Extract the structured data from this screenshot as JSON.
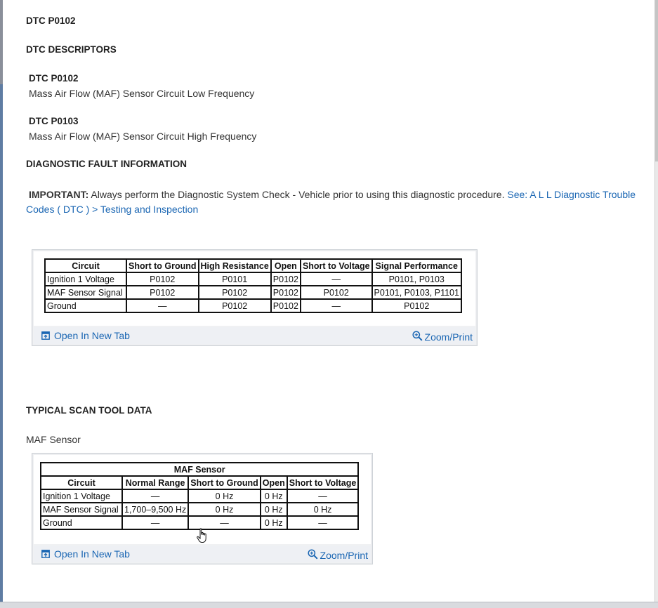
{
  "page": {
    "dtc_title": "DTC P0102",
    "descriptors_heading": "DTC DESCRIPTORS",
    "descriptors": [
      {
        "code": "DTC P0102",
        "desc": "Mass Air Flow (MAF) Sensor Circuit Low Frequency"
      },
      {
        "code": "DTC P0103",
        "desc": "Mass Air Flow (MAF) Sensor Circuit High Frequency"
      }
    ],
    "fault_heading": "DIAGNOSTIC FAULT INFORMATION",
    "important_label": "IMPORTANT:",
    "important_text": " Always perform the Diagnostic System Check - Vehicle prior to using this diagnostic procedure. ",
    "important_link": "See: A L L Diagnostic Trouble Codes ( DTC ) > Testing and Inspection",
    "scan_heading": "TYPICAL SCAN TOOL DATA",
    "maf_label": "MAF Sensor"
  },
  "figure_bar": {
    "open_tab": "Open In New Tab",
    "zoom_print": "Zoom/Print"
  },
  "fault_table": {
    "headers": [
      "Circuit",
      "Short to Ground",
      "High Resistance",
      "Open",
      "Short to Voltage",
      "Signal Performance"
    ],
    "rows": [
      [
        "Ignition 1 Voltage",
        "P0102",
        "P0101",
        "P0102",
        "—",
        "P0101, P0103"
      ],
      [
        "MAF Sensor Signal",
        "P0102",
        "P0102",
        "P0102",
        "P0102",
        "P0101, P0103, P1101"
      ],
      [
        "Ground",
        "—",
        "P0102",
        "P0102",
        "—",
        "P0102"
      ]
    ]
  },
  "scan_table": {
    "title": "MAF Sensor",
    "headers": [
      "Circuit",
      "Normal Range",
      "Short to Ground",
      "Open",
      "Short to Voltage"
    ],
    "rows": [
      [
        "Ignition 1 Voltage",
        "—",
        "0 Hz",
        "0 Hz",
        "—"
      ],
      [
        "MAF Sensor Signal",
        "1,700–9,500 Hz",
        "0 Hz",
        "0 Hz",
        "0 Hz"
      ],
      [
        "Ground",
        "—",
        "—",
        "0 Hz",
        "—"
      ]
    ]
  },
  "colors": {
    "link": "#1a66b3",
    "text": "#333333",
    "table_border": "#111111"
  },
  "icons": [
    "open-in-new-tab-icon",
    "zoom-icon",
    "hand-cursor-icon"
  ]
}
